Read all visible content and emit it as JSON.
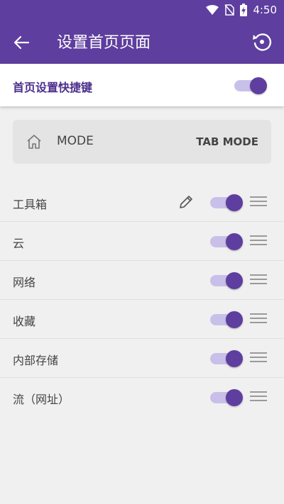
{
  "status_bar": {
    "time": "4:50"
  },
  "app_bar": {
    "title": "设置首页页面"
  },
  "shortcut": {
    "label": "首页设置快捷键",
    "enabled": true
  },
  "mode_card": {
    "label": "MODE",
    "action": "TAB MODE"
  },
  "items": [
    {
      "label": "工具箱",
      "enabled": true,
      "editable": true
    },
    {
      "label": "云",
      "enabled": true
    },
    {
      "label": "网络",
      "enabled": true
    },
    {
      "label": "收藏",
      "enabled": true
    },
    {
      "label": "内部存储",
      "enabled": true
    },
    {
      "label": "流（网址）",
      "enabled": true
    }
  ],
  "colors": {
    "primary": "#5e3e9e",
    "track": "#c9c0ea",
    "background": "#f0f0f0"
  }
}
